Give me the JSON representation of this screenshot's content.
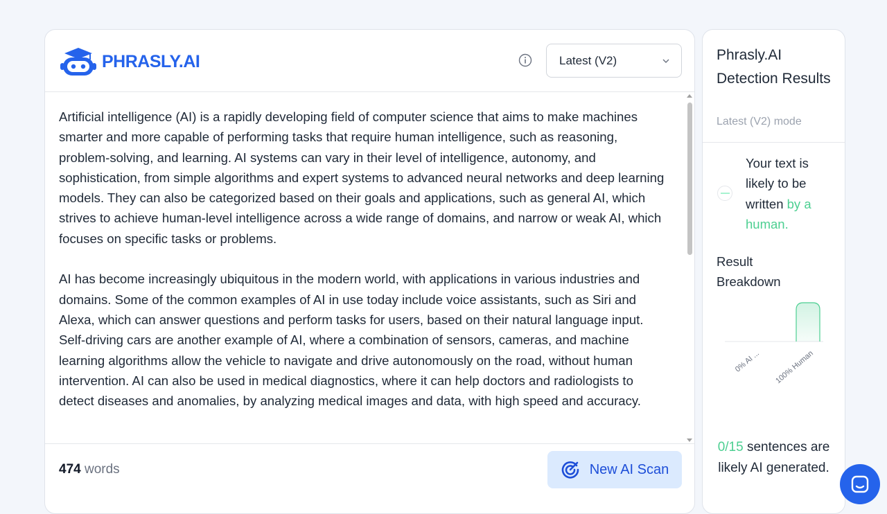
{
  "header": {
    "logo_text": "PHRASLY.AI",
    "model_select": {
      "selected": "Latest (V2)"
    }
  },
  "editor": {
    "paragraphs": [
      "Artificial intelligence (AI) is a rapidly developing field of computer science that aims to make machines smarter and more capable of performing tasks that require human intelligence, such as reasoning, problem-solving, and learning. AI systems can vary in their level of intelligence, autonomy, and sophistication, from simple algorithms and expert systems to advanced neural networks and deep learning models. They can also be categorized based on their goals and applications, such as general AI, which strives to achieve human-level intelligence across a wide range of domains, and narrow or weak AI, which focuses on specific tasks or problems.",
      "AI has become increasingly ubiquitous in the modern world, with applications in various industries and domains. Some of the common examples of AI in use today include voice assistants, such as Siri and Alexa, which can answer questions and perform tasks for users, based on their natural language input. Self-driving cars are another example of AI, where a combination of sensors, cameras, and machine learning algorithms allow the vehicle to navigate and drive autonomously on the road, without human intervention. AI can also be used in medical diagnostics, where it can help doctors and radiologists to detect diseases and anomalies, by analyzing medical images and data, with high speed and accuracy."
    ],
    "word_count": "474",
    "word_count_label": "words",
    "scan_button_label": "New AI Scan"
  },
  "results": {
    "title": "Phrasly.AI Detection Results",
    "mode": "Latest (V2) mode",
    "verdict_prefix": "Your text is likely to be written",
    "verdict_highlight": "by a human.",
    "breakdown_title": "Result Breakdown",
    "sentences_count": "0/15",
    "sentences_suffix": "sentences are likely AI generated."
  },
  "chart_data": {
    "type": "bar",
    "categories": [
      "0% AI ...",
      "100% Human"
    ],
    "values": [
      0,
      100
    ],
    "ylim": [
      0,
      100
    ],
    "grid": false,
    "colors": [
      "#4ccf91",
      "#4ccf91"
    ]
  },
  "colors": {
    "brand": "#2563eb",
    "human_green": "#4ccf91",
    "scan_bg": "#dbeafe"
  }
}
